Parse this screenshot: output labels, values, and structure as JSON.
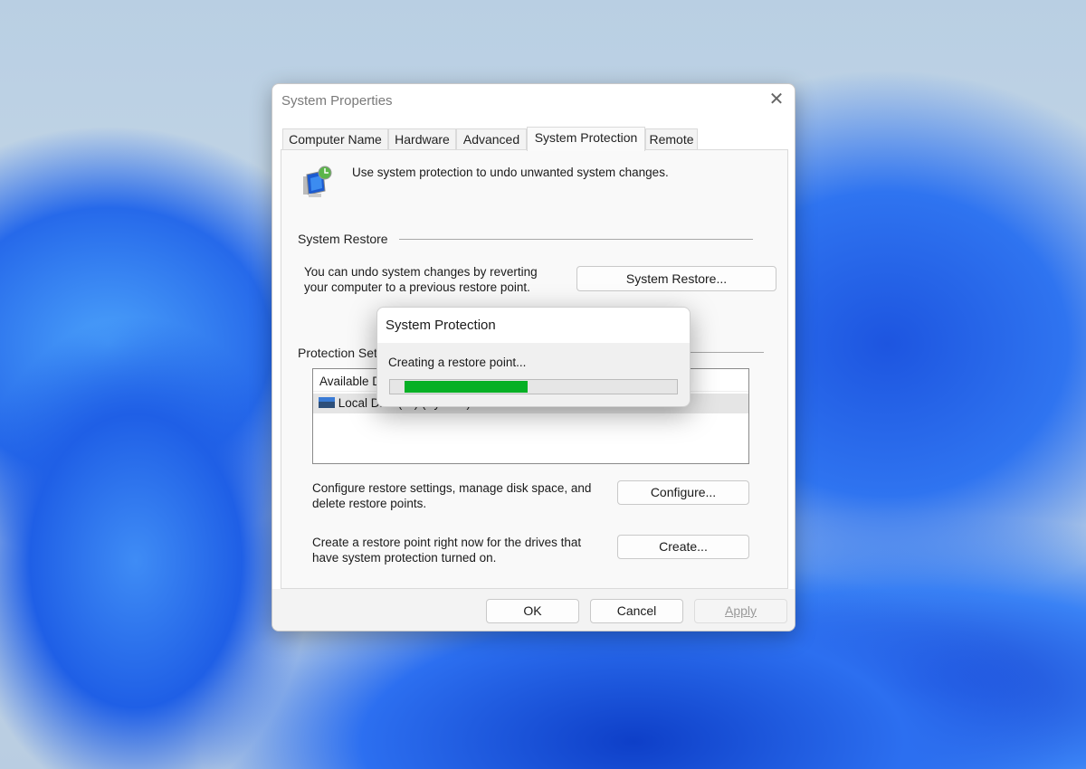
{
  "window": {
    "title": "System Properties",
    "close_icon": "close-icon"
  },
  "tabs": [
    {
      "label": "Computer Name"
    },
    {
      "label": "Hardware"
    },
    {
      "label": "Advanced"
    },
    {
      "label": "System Protection",
      "selected": true
    },
    {
      "label": "Remote"
    }
  ],
  "header": {
    "icon": "system-protection-icon",
    "text": "Use system protection to undo unwanted system changes."
  },
  "system_restore": {
    "title": "System Restore",
    "description_line1": "You can undo system changes by reverting",
    "description_line2": "your computer to a previous restore point.",
    "button": "System Restore..."
  },
  "protection_settings": {
    "title": "Protection Settings",
    "columns": [
      "Available Drives"
    ],
    "rows": [
      {
        "icon": "drive-icon",
        "name": "Local Disk (C:) (System)"
      }
    ]
  },
  "configure": {
    "line1": "Configure restore settings, manage disk space, and",
    "line2": "delete restore points.",
    "button": "Configure..."
  },
  "create": {
    "line1": "Create a restore point right now for the drives that",
    "line2": "have system protection turned on.",
    "button": "Create..."
  },
  "footer": {
    "ok": "OK",
    "cancel": "Cancel",
    "apply": "Apply",
    "apply_enabled": false
  },
  "popup": {
    "title": "System Protection",
    "message": "Creating a restore point...",
    "progress_segment_start_pct": 5,
    "progress_segment_end_pct": 48,
    "progress_color": "#06b025"
  }
}
